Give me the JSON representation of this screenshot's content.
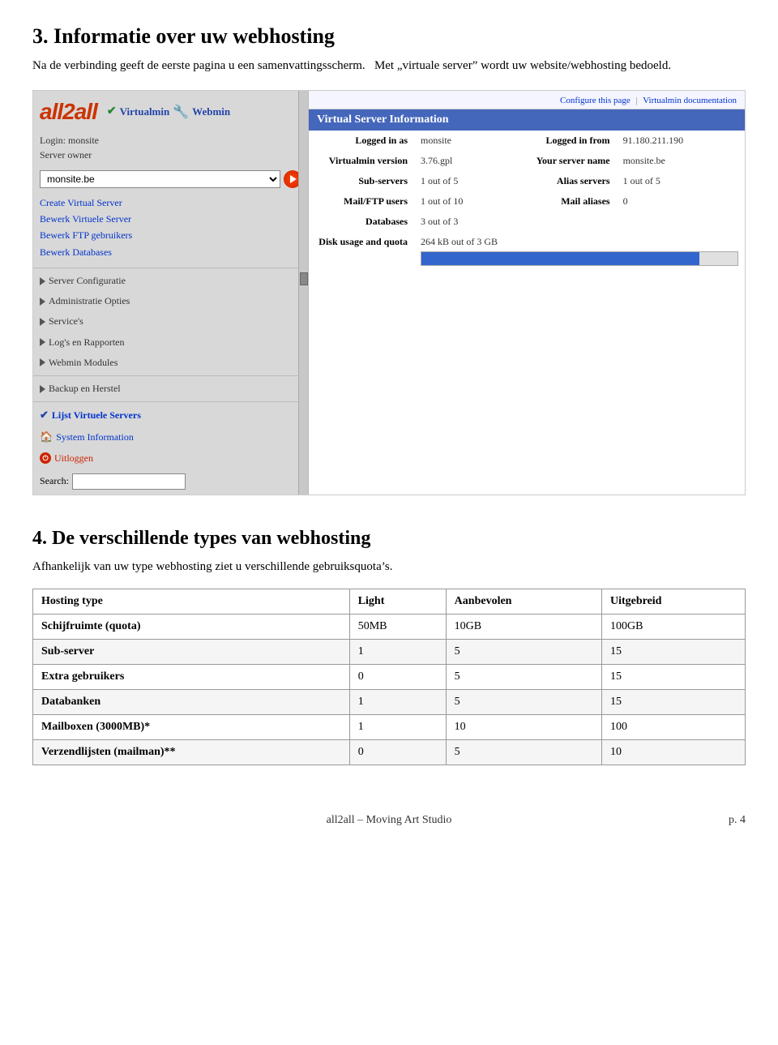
{
  "section3": {
    "title": "3. Informatie over uw webhosting",
    "intro1": "Na de verbinding geeft de eerste pagina u een samenvattingsscherm.",
    "intro2": "Met „virtuale server” wordt uw website/webhosting bedoeld."
  },
  "sidebar": {
    "logo_text": "all2all",
    "virtualmin_label": "Virtualmin",
    "webmin_label": "Webmin",
    "login_label": "Login: monsite",
    "server_owner_label": "Server owner",
    "dropdown_value": "monsite.be",
    "links": [
      "Create Virtual Server",
      "Bewerk Virtuele Server",
      "Bewerk FTP gebruikers",
      "Bewerk Databases"
    ],
    "collapsible_items": [
      "Server Configuratie",
      "Administratie Opties",
      "Service's",
      "Log's en Rapporten",
      "Webmin Modules"
    ],
    "collapsible2_items": [
      "Backup en Herstel"
    ],
    "active_item": "Lijst Virtuele Servers",
    "system_info_label": "System Information",
    "uitloggen_label": "Uitloggen",
    "search_label": "Search:"
  },
  "panel": {
    "configure_link": "Configure this page",
    "virtualmin_doc_link": "Virtualmin documentation",
    "title": "Virtual Server Information",
    "logged_in_as_label": "Logged in as",
    "logged_in_as_value": "monsite",
    "logged_in_from_label": "Logged in from",
    "logged_in_from_value": "91.180.211.190",
    "virtualmin_version_label": "Virtualmin version",
    "virtualmin_version_value": "3.76.gpl",
    "server_name_label": "Your server name",
    "server_name_value": "monsite.be",
    "sub_servers_label": "Sub-servers",
    "sub_servers_value": "1 out of 5",
    "alias_servers_label": "Alias servers",
    "alias_servers_value": "1 out of 5",
    "mail_ftp_label": "Mail/FTP users",
    "mail_ftp_value": "1 out of 10",
    "mail_aliases_label": "Mail aliases",
    "mail_aliases_value": "0",
    "databases_label": "Databases",
    "databases_value": "3 out of 3",
    "disk_usage_label": "Disk usage and quota",
    "disk_usage_value": "264 kB out of 3 GB",
    "disk_bar_percent": 88
  },
  "section4": {
    "title": "4. De verschillende types van webhosting",
    "intro": "Afhankelijk van uw type webhosting ziet u verschillende gebruiksquota’s.",
    "table_headers": [
      "Hosting type",
      "Light",
      "Aanbevolen",
      "Uitgebreid"
    ],
    "table_rows": [
      [
        "Schijfruimte (quota)",
        "50MB",
        "10GB",
        "100GB"
      ],
      [
        "Sub-server",
        "1",
        "5",
        "15"
      ],
      [
        "Extra gebruikers",
        "0",
        "5",
        "15"
      ],
      [
        "Databanken",
        "1",
        "5",
        "15"
      ],
      [
        "Mailboxen (3000MB)*",
        "1",
        "10",
        "100"
      ],
      [
        "Verzendlijsten (mailman)**",
        "0",
        "5",
        "10"
      ]
    ]
  },
  "footer": {
    "center_text": "all2all – Moving Art Studio",
    "page_text": "p. 4"
  }
}
